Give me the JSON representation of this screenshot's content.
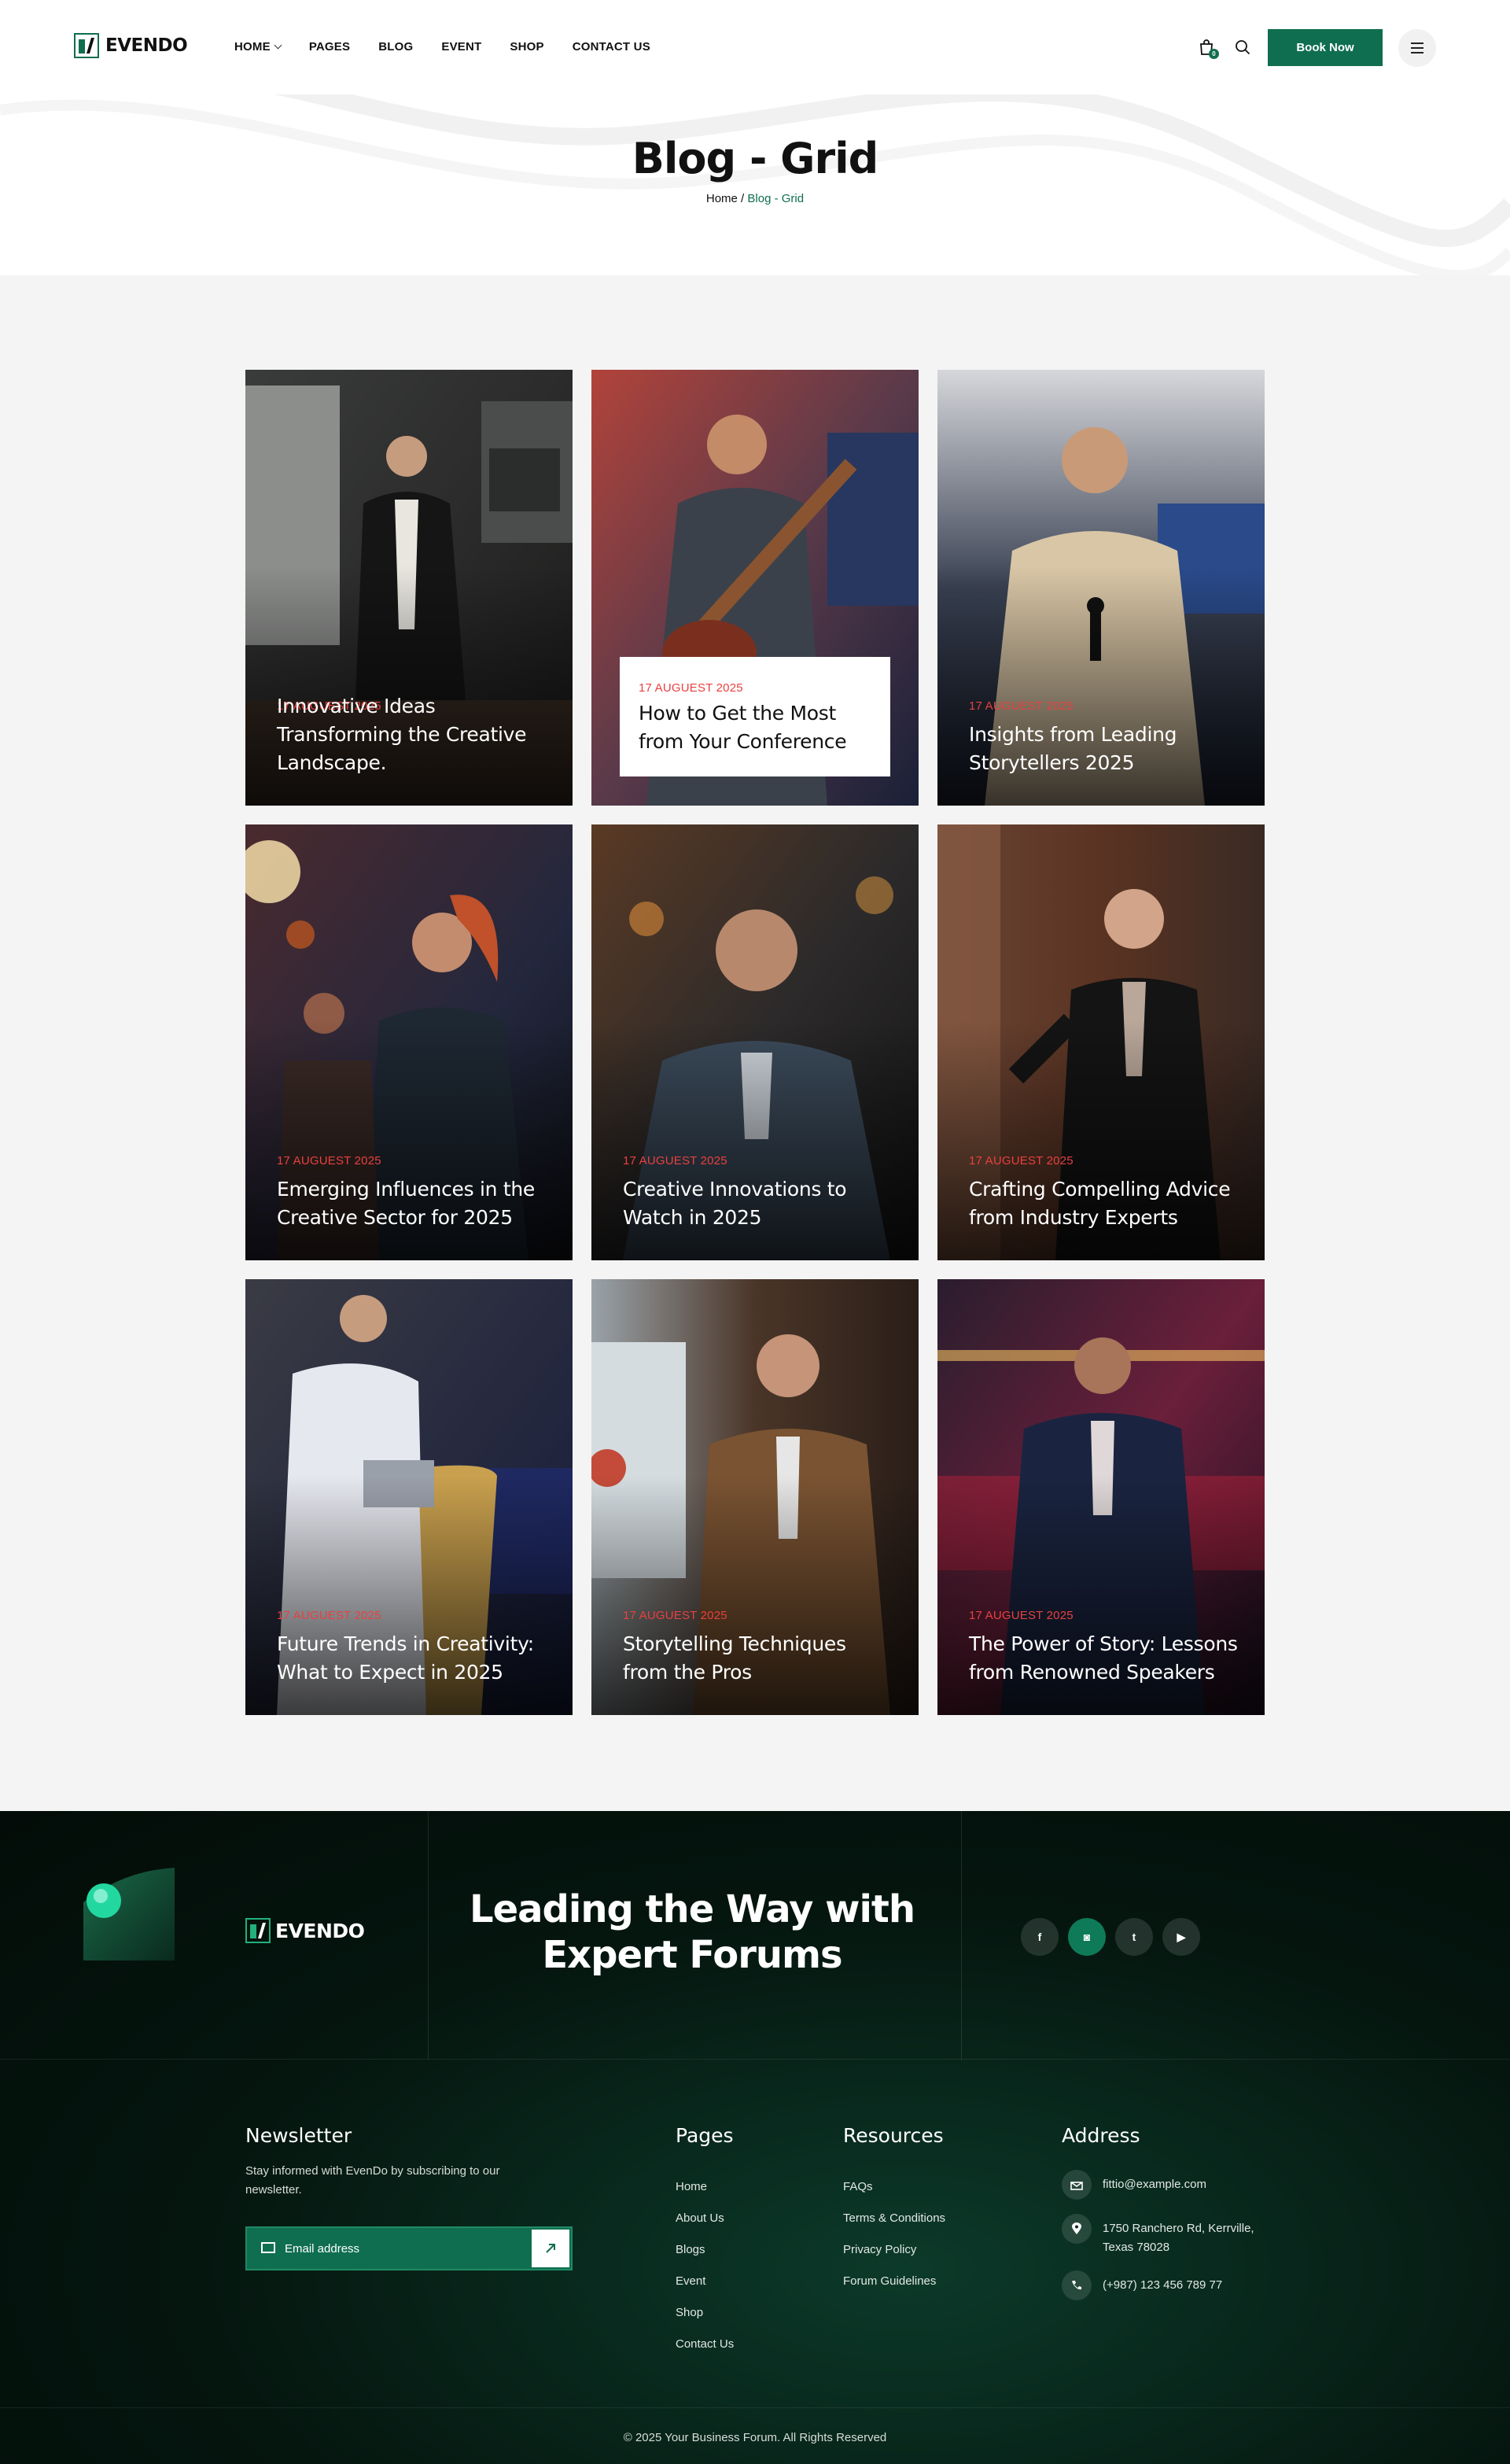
{
  "brand": {
    "name": "EVENDO",
    "accent": "#0f6e4f",
    "date_color": "#e8413f"
  },
  "nav": {
    "items": [
      {
        "label": "HOME",
        "has_dropdown": true
      },
      {
        "label": "PAGES"
      },
      {
        "label": "BLOG"
      },
      {
        "label": "EVENT"
      },
      {
        "label": "SHOP"
      },
      {
        "label": "CONTACT US"
      }
    ],
    "cart_count": "0",
    "book_label": "Book Now"
  },
  "hero": {
    "title": "Blog - Grid",
    "breadcrumb_home": "Home",
    "breadcrumb_sep": " / ",
    "breadcrumb_current": "Blog - Grid"
  },
  "posts": [
    {
      "date": "17 AUGUEST 2025",
      "title": "Innovative Ideas Transforming the Creative Landscape."
    },
    {
      "date": "17 AUGUEST 2025",
      "title": "How to Get the Most from Your Conference"
    },
    {
      "date": "17 AUGUEST 2025",
      "title": "Insights from Leading Storytellers 2025"
    },
    {
      "date": "17 AUGUEST 2025",
      "title": "Emerging Influences in the Creative Sector for 2025"
    },
    {
      "date": "17 AUGUEST 2025",
      "title": "Creative Innovations to Watch in 2025"
    },
    {
      "date": "17 AUGUEST 2025",
      "title": "Crafting Compelling  Advice from Industry Experts"
    },
    {
      "date": "17 AUGUEST 2025",
      "title": "Future Trends in Creativity: What to Expect in 2025"
    },
    {
      "date": "17 AUGUEST 2025",
      "title": "Storytelling Techniques from the Pros"
    },
    {
      "date": "17 AUGUEST 2025",
      "title": "The Power of Story: Lessons from Renowned Speakers"
    }
  ],
  "footer": {
    "logo": "EVENDO",
    "headline_1": "Leading the Way with",
    "headline_2": "Expert Forums",
    "socials": [
      {
        "icon": "facebook-icon",
        "glyph": "f"
      },
      {
        "icon": "instagram-icon",
        "glyph": "◙"
      },
      {
        "icon": "twitter-icon",
        "glyph": "t"
      },
      {
        "icon": "youtube-icon",
        "glyph": "▶"
      }
    ],
    "newsletter": {
      "title": "Newsletter",
      "text": "Stay informed with EvenDo by subscribing to our newsletter.",
      "placeholder": "Email address"
    },
    "pages": {
      "title": "Pages",
      "links": [
        "Home",
        "About Us",
        "Blogs",
        "Event",
        "Shop",
        "Contact Us"
      ]
    },
    "resources": {
      "title": "Resources",
      "links": [
        "FAQs",
        "Terms & Conditions",
        "Privacy Policy",
        "Forum Guidelines"
      ]
    },
    "address": {
      "title": "Address",
      "email": "fittio@example.com",
      "street_1": "1750 Ranchero Rd, Kerrville,",
      "street_2": "Texas 78028",
      "phone": "(+987) 123 456 789 77"
    },
    "copyright": "© 2025 Your Business Forum. All Rights Reserved"
  }
}
